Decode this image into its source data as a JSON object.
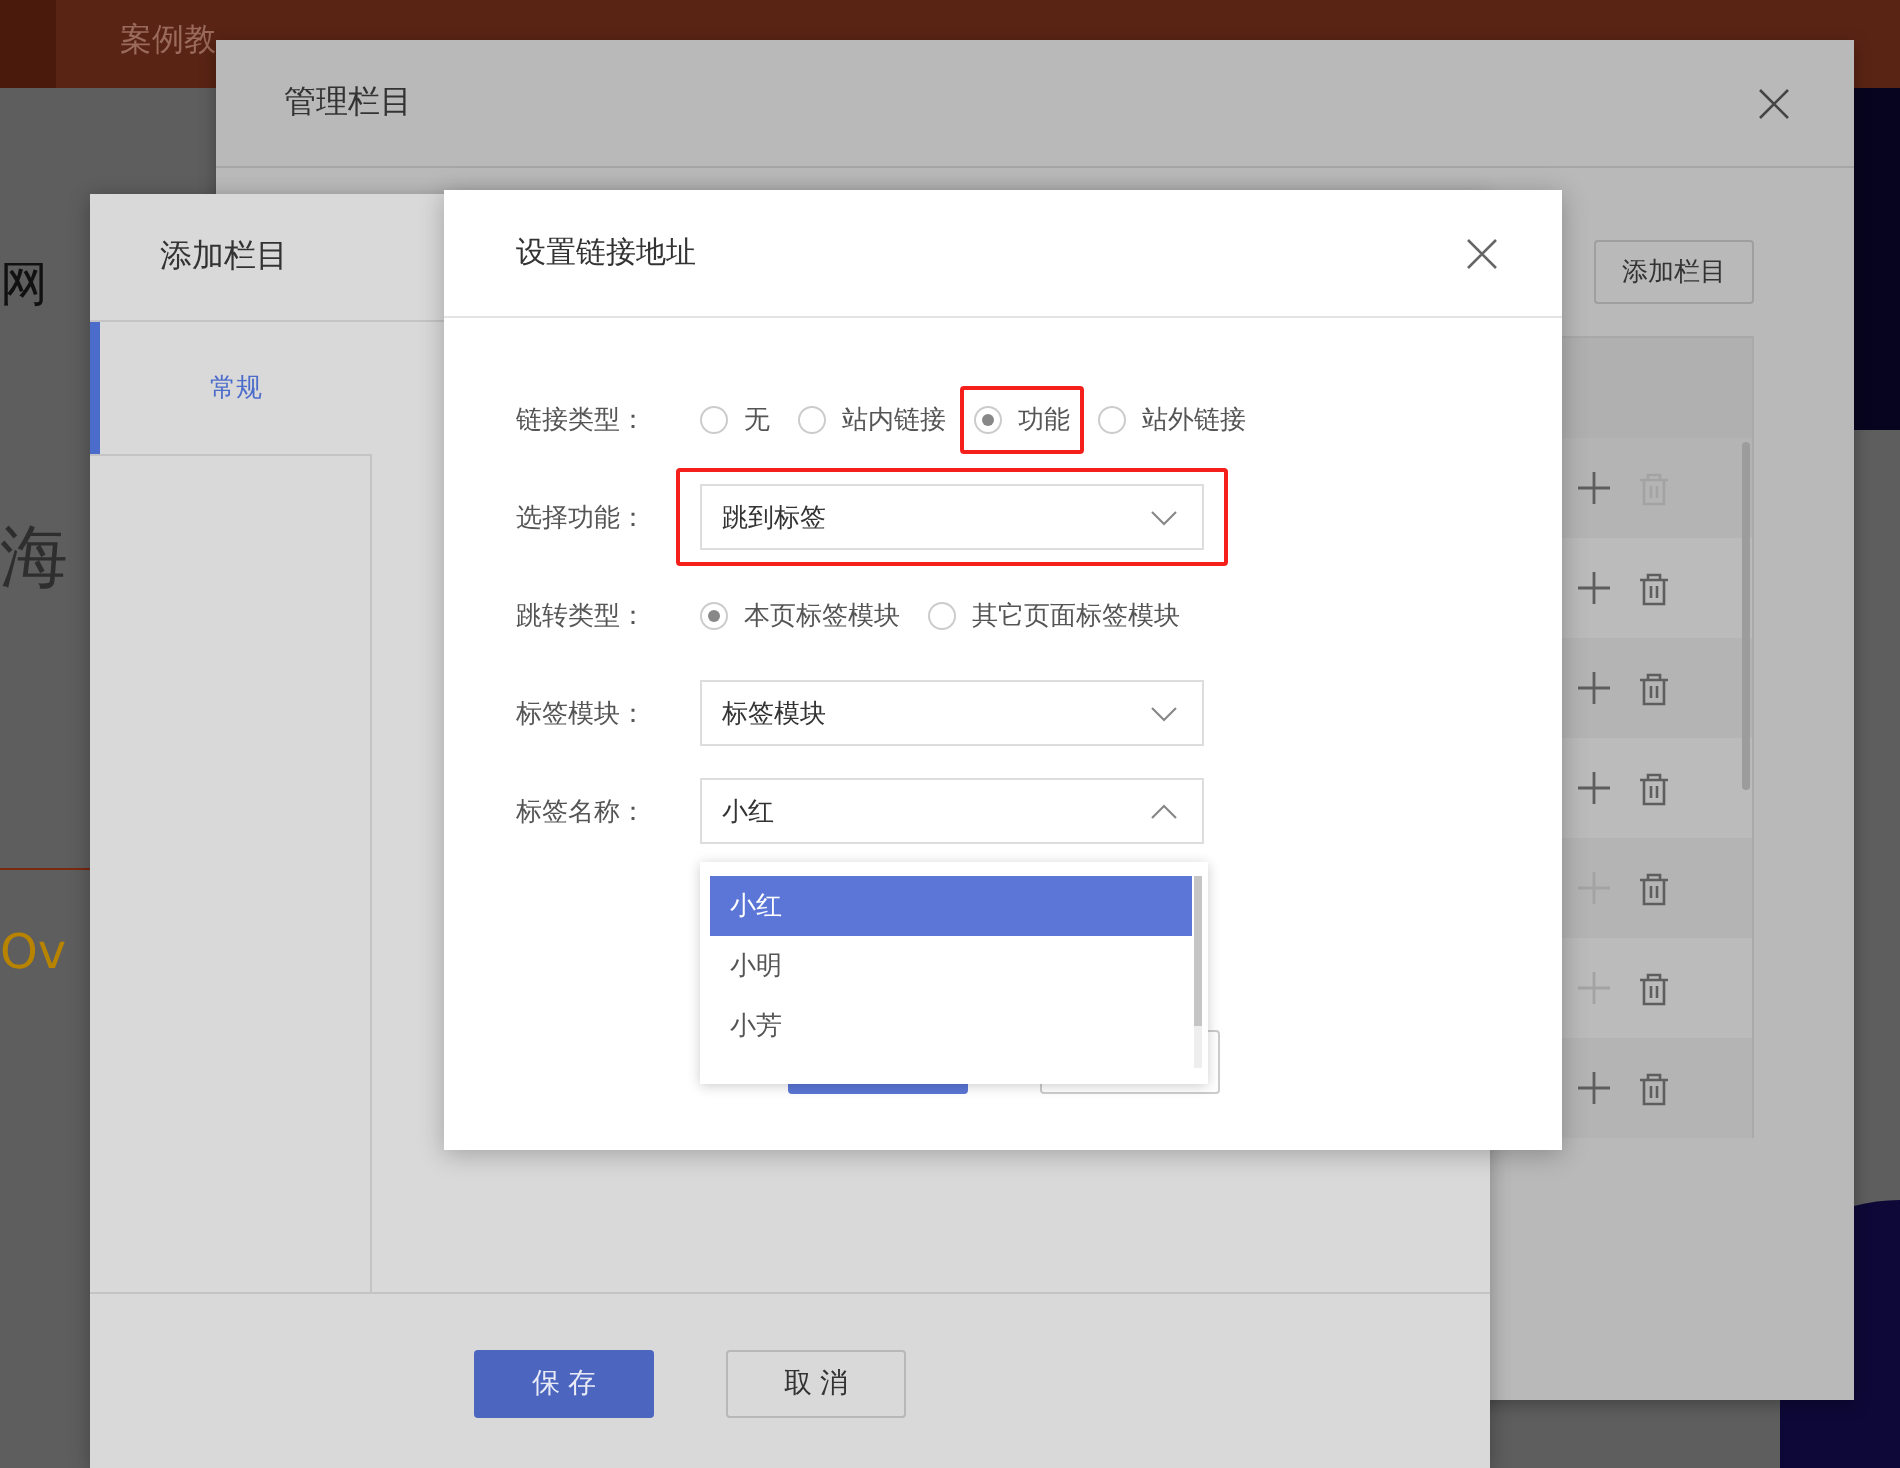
{
  "background_site": {
    "nav": [
      "案例教"
    ],
    "texts": [
      "网",
      "海",
      "Ov"
    ]
  },
  "manage_window": {
    "title": "管理栏目",
    "add_button": "添加栏目",
    "rows": [
      {
        "add_disabled": false,
        "delete_disabled": true
      },
      {
        "add_disabled": false,
        "delete_disabled": false
      },
      {
        "add_disabled": false,
        "delete_disabled": false
      },
      {
        "add_disabled": false,
        "delete_disabled": false
      },
      {
        "add_disabled": true,
        "delete_disabled": false
      },
      {
        "add_disabled": true,
        "delete_disabled": false
      },
      {
        "add_disabled": false,
        "delete_disabled": false
      }
    ]
  },
  "add_window": {
    "title": "添加栏目",
    "tabs": [
      {
        "label": "常规",
        "selected": true
      }
    ],
    "buttons": [
      {
        "label": "保 存",
        "kind": "primary"
      },
      {
        "label": "取 消",
        "kind": "secondary"
      }
    ]
  },
  "link_dialog": {
    "title": "设置链接地址",
    "fields": [
      {
        "kind": "radio",
        "label": "链接类型：",
        "options": [
          {
            "label": "无",
            "selected": false,
            "highlighted": false
          },
          {
            "label": "站内链接",
            "selected": false,
            "highlighted": false
          },
          {
            "label": "功能",
            "selected": true,
            "highlighted": true
          },
          {
            "label": "站外链接",
            "selected": false,
            "highlighted": false
          }
        ]
      },
      {
        "kind": "select",
        "label": "选择功能：",
        "value": "跳到标签",
        "expanded": false,
        "highlighted": true
      },
      {
        "kind": "radio",
        "label": "跳转类型：",
        "options": [
          {
            "label": "本页标签模块",
            "selected": true,
            "highlighted": false
          },
          {
            "label": "其它页面标签模块",
            "selected": false,
            "highlighted": false
          }
        ]
      },
      {
        "kind": "select",
        "label": "标签模块：",
        "value": "标签模块",
        "expanded": false,
        "highlighted": false
      },
      {
        "kind": "select",
        "label": "标签名称：",
        "value": "小红",
        "expanded": true,
        "highlighted": false,
        "options": [
          {
            "label": "小红",
            "selected": true
          },
          {
            "label": "小明",
            "selected": false
          },
          {
            "label": "小芳",
            "selected": false
          }
        ]
      }
    ],
    "buttons": [
      {
        "kind": "primary"
      },
      {
        "kind": "secondary"
      }
    ]
  }
}
